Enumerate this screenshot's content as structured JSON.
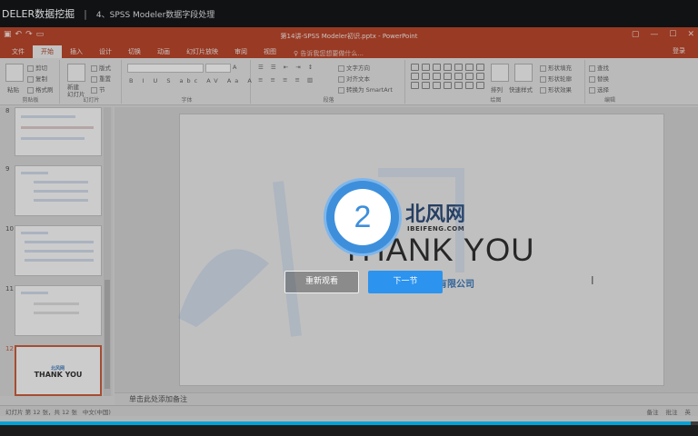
{
  "video": {
    "course_title": "DELER数据挖掘",
    "lesson_title": "4、SPSS Modeler数据字段处理",
    "progress_fraction": 0.99
  },
  "powerpoint": {
    "window_title": "第14讲-SPSS Modeler初识.pptx - PowerPoint",
    "signin": "登录",
    "tell_me": "♀ 告诉我您想要做什么...",
    "tabs": [
      "文件",
      "开始",
      "插入",
      "设计",
      "切换",
      "动画",
      "幻灯片放映",
      "审阅",
      "视图"
    ],
    "active_tab": "开始",
    "ribbon": {
      "clipboard": {
        "label": "剪贴板",
        "paste": "粘贴",
        "cut": "剪切",
        "copy": "复制",
        "format_painter": "格式刷"
      },
      "slides": {
        "label": "幻灯片",
        "new_slide": "新建\n幻灯片",
        "layout": "版式",
        "reset": "重置",
        "section": "节"
      },
      "font": {
        "label": "字体"
      },
      "paragraph": {
        "label": "段落",
        "text_direction": "文字方向",
        "align_text": "对齐文本",
        "smartart": "转换为 SmartArt"
      },
      "drawing": {
        "label": "绘图",
        "arrange": "排列",
        "quick_styles": "快速样式",
        "shape_fill": "形状填充",
        "shape_outline": "形状轮廓",
        "shape_effects": "形状效果"
      },
      "editing": {
        "label": "编辑",
        "find": "查找",
        "replace": "替换",
        "select": "选择"
      }
    },
    "thumbnails": [
      {
        "num": "8",
        "text": ""
      },
      {
        "num": "9",
        "text": ""
      },
      {
        "num": "10",
        "text": ""
      },
      {
        "num": "11",
        "text": ""
      },
      {
        "num": "12",
        "text": "THANK YOU"
      }
    ],
    "slide": {
      "brand_cn": "北风网",
      "brand_en": "IBEIFENG.COM",
      "headline": "THANK YOU",
      "company": "有限公司"
    },
    "notes_placeholder": "单击此处添加备注",
    "status": {
      "slide_count": "幻灯片 第 12 张，共 12 张",
      "language": "中文(中国)",
      "notes": "备注",
      "comments": "批注",
      "ime": "英"
    }
  },
  "player": {
    "countdown": "2",
    "replay_label": "重新观看",
    "next_label": "下一节"
  },
  "colors": {
    "ribbon_red": "#b0381c",
    "player_blue": "#2c93ef",
    "countdown_blue": "#3d8fdc"
  }
}
